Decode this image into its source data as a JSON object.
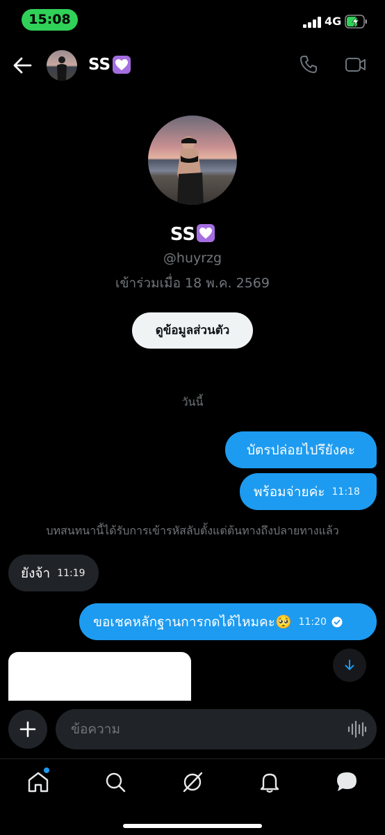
{
  "status_bar": {
    "time": "15:08",
    "network": "4G",
    "time_pill_color": "#30d158"
  },
  "header": {
    "name": "SS",
    "name_badge_icon": "heart-badge-icon"
  },
  "profile": {
    "name": "SS",
    "handle": "@huyrzg",
    "joined": "เข้าร่วมเมื่อ 18 พ.ค. 2569",
    "view_profile_button": "ดูข้อมูลส่วนตัว"
  },
  "conversation": {
    "date_separator": "วันนี้",
    "messages": [
      {
        "direction": "outgoing",
        "text": "บัตรปล่อยไปรึยังคะ",
        "time": ""
      },
      {
        "direction": "outgoing",
        "text": "พร้อมจ่ายค่ะ",
        "time": "11:18"
      },
      {
        "direction": "incoming",
        "text": "ยังจ้า",
        "time": "11:19"
      },
      {
        "direction": "outgoing",
        "text": "ขอเชคหลักฐานการกดได้ไหมคะ🥺",
        "time": "11:20",
        "read": true
      }
    ],
    "encryption_notice": "บทสนทนานี้ได้รับการเข้ารหัสลับตั้งแต่ต้นทางถึงปลายทางแล้ว"
  },
  "composer": {
    "placeholder": "ข้อความ"
  },
  "tabs": [
    "home",
    "search",
    "grok",
    "notifications",
    "messages"
  ],
  "colors": {
    "accent": "#1d9bf0",
    "incoming_bubble": "#202327",
    "background": "#000000",
    "muted_text": "#71767b"
  }
}
